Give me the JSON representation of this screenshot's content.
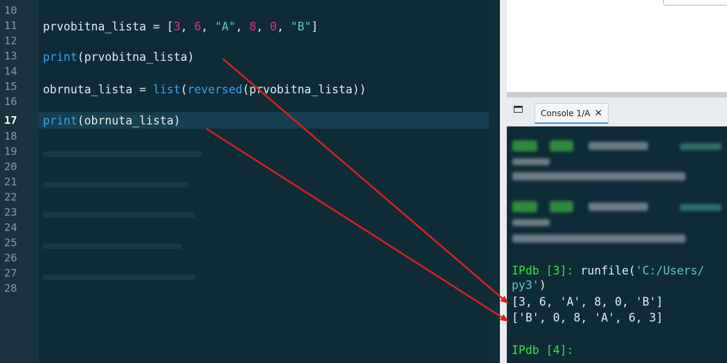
{
  "editor": {
    "line_numbers": [
      "10",
      "11",
      "12",
      "13",
      "14",
      "15",
      "16",
      "17",
      "18",
      "19",
      "20",
      "21",
      "22",
      "23",
      "24",
      "25",
      "26",
      "27",
      "28"
    ],
    "active_line": "17",
    "lines": {
      "l11": {
        "var": "prvobitna_lista = [",
        "n1": "3",
        "c1": ", ",
        "n2": "6",
        "c2": ", ",
        "s1": "\"A\"",
        "c3": ", ",
        "n3": "8",
        "c4": ", ",
        "n4": "0",
        "c5": ", ",
        "s2": "\"B\"",
        "end": "]"
      },
      "l13": {
        "fn": "print",
        "rest": "(prvobitna_lista)"
      },
      "l15": {
        "start": "obrnuta_lista = ",
        "fn1": "list",
        "mid": "(",
        "fn2": "reversed",
        "rest": "(prvobitna_lista))"
      },
      "l17": {
        "fn": "print",
        "rest": "(obrnuta_lista)"
      }
    }
  },
  "console_tab": {
    "label": "Console 1/A",
    "close": "✕"
  },
  "console": {
    "run_prompt": "IPdb [",
    "run_num": "3",
    "run_prompt_end": "]: ",
    "run_cmd": "runfile(",
    "run_path": "'C:/Users/",
    "run_path2": "py3'",
    "run_close": ")",
    "out1": "[3, 6, 'A', 8, 0, 'B']",
    "out2": "['B', 0, 8, 'A', 6, 3]",
    "next_prompt": "IPdb [",
    "next_num": "4",
    "next_prompt_end": "]:"
  },
  "colors": {
    "background": "#0f2b38",
    "number": "#e3357a",
    "string": "#5fc8c4",
    "builtin": "#3aa6e6",
    "prompt": "#3ae23a",
    "arrow": "#e02020"
  }
}
